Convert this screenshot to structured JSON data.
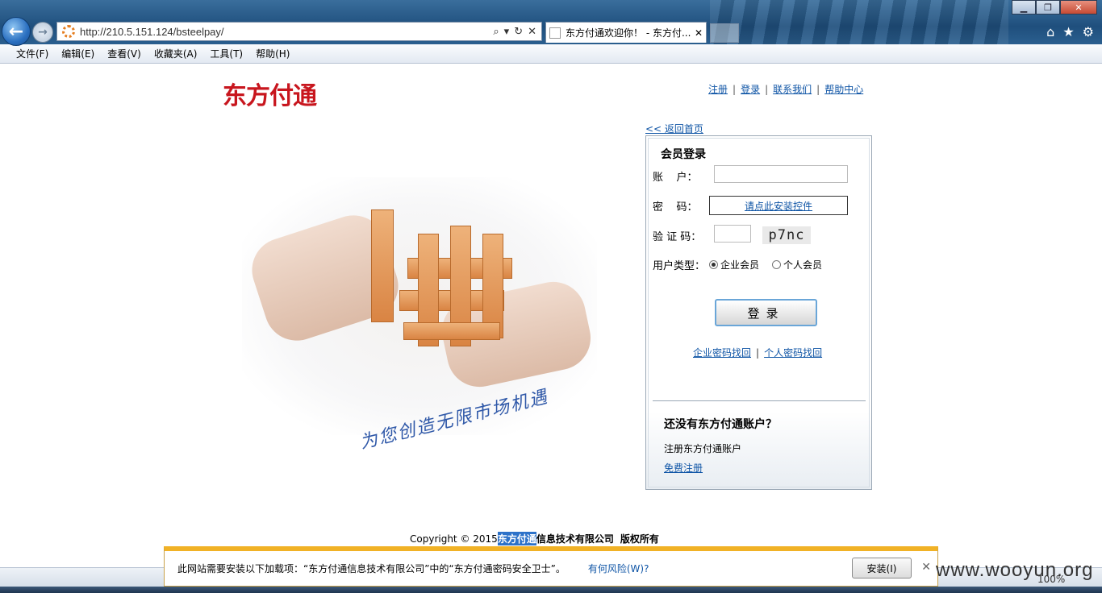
{
  "browser": {
    "url": "http://210.5.151.124/bsteelpay/",
    "tab_title": "东方付通欢迎你！ - 东方付...",
    "menus": [
      "文件(F)",
      "编辑(E)",
      "查看(V)",
      "收藏夹(A)",
      "工具(T)",
      "帮助(H)"
    ],
    "zoom": "100%"
  },
  "header": {
    "logo": "东方付通",
    "links": [
      "注册",
      "登录",
      "联系我们",
      "帮助中心"
    ]
  },
  "hero": {
    "slogan": "为您创造无限市场机遇"
  },
  "login": {
    "back_home": "<< 返回首页",
    "title": "会员登录",
    "account_label": "账    户：",
    "password_label": "密    码：",
    "password_install_link": "请点此安装控件",
    "captcha_label": "验 证 码：",
    "captcha_text": "p7nc",
    "user_type_label": "用户类型：",
    "user_types": [
      {
        "label": "企业会员",
        "selected": true
      },
      {
        "label": "个人会员",
        "selected": false
      }
    ],
    "login_button": "登录",
    "recover_links": [
      "企业密码找回",
      "个人密码找回"
    ],
    "no_account_title": "还没有东方付通账户？",
    "register_text": "注册东方付通账户",
    "free_register": "免费注册"
  },
  "footer": {
    "copyright_prefix": "Copyright © 2015 ",
    "company_highlight": "东方付通",
    "company_rest": "信息技术有限公司",
    "rights": "版权所有"
  },
  "notification": {
    "message": "此网站需要安装以下加载项：“东方付通信息技术有限公司”中的“东方付通密码安全卫士”。",
    "risk_link": "有何风险(W)?",
    "install_button": "安装(I)"
  },
  "watermark": "www.wooyun.org",
  "colors": {
    "brand_red": "#c8161e",
    "link_blue": "#0f55a6",
    "notify_bar": "#f1b226"
  }
}
